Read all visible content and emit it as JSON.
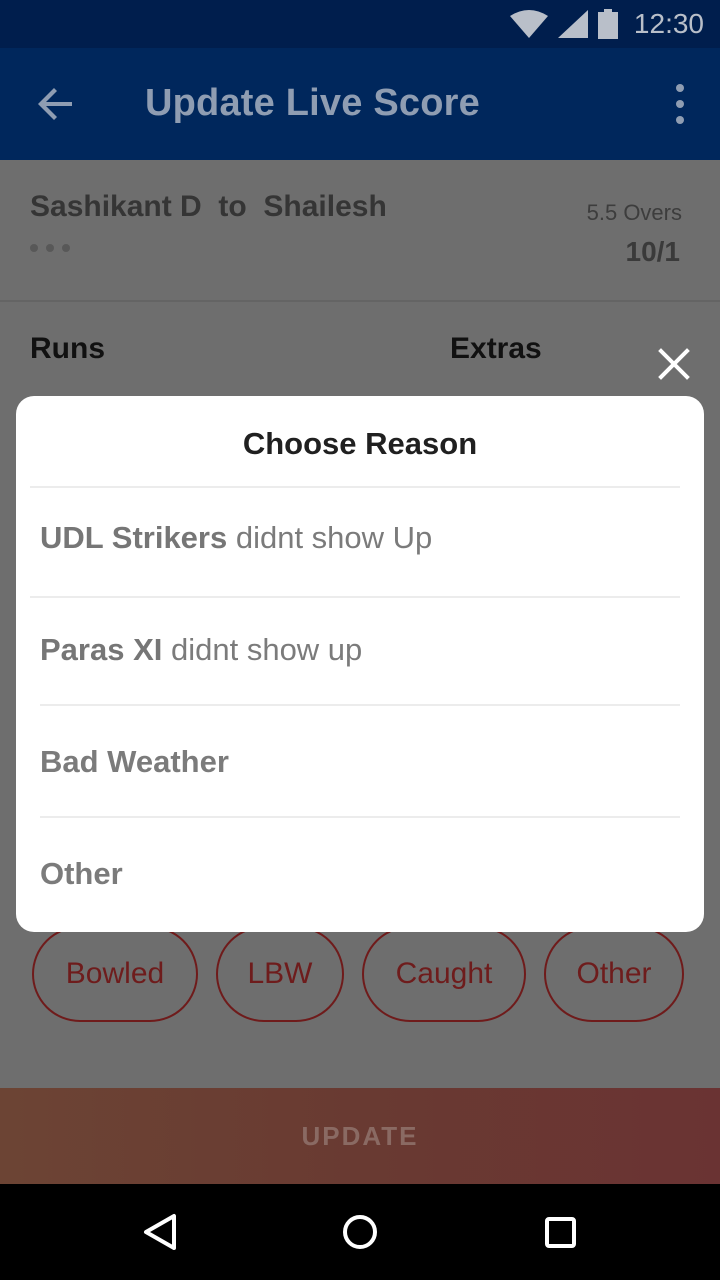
{
  "status_bar": {
    "time": "12:30"
  },
  "app_bar": {
    "title": "Update Live Score"
  },
  "ball": {
    "bowler": "Sashikant D",
    "connector": "to",
    "batsman": "Shailesh",
    "overs": "5.5 Overs",
    "score": "10/1"
  },
  "sections": {
    "runs": "Runs",
    "extras": "Extras"
  },
  "dialog": {
    "title": "Choose Reason",
    "reasons": [
      {
        "team": "UDL Strikers",
        "text": " didnt show Up"
      },
      {
        "team": "Paras XI",
        "text": " didnt show up"
      },
      {
        "label": "Bad Weather"
      },
      {
        "label": "Other"
      }
    ]
  },
  "wickets": [
    "Bowled",
    "LBW",
    "Caught",
    "Other"
  ],
  "update_label": "UPDATE",
  "icons": {
    "back": "arrow-back-icon",
    "menu": "more-vert-icon",
    "close": "close-icon",
    "wifi": "wifi-icon",
    "signal": "signal-icon",
    "battery": "battery-icon"
  },
  "colors": {
    "app_bar": "#00275c",
    "status_bar": "#001e4d",
    "wicket_accent": "#6e1c1c",
    "dialog_bg": "#ffffff"
  }
}
